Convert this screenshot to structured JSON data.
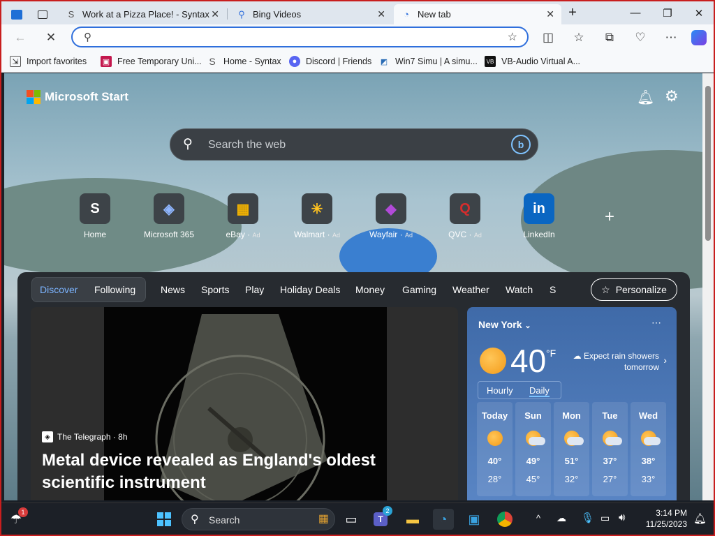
{
  "tabs": [
    {
      "title": "Work at a Pizza Place! - Syntax",
      "icon": "syntax-icon"
    },
    {
      "title": "Bing Videos",
      "icon": "search-icon"
    },
    {
      "title": "New tab",
      "icon": "edge-icon",
      "active": true
    }
  ],
  "address_bar": {
    "value": "",
    "placeholder": ""
  },
  "favorites": [
    {
      "label": "Import favorites"
    },
    {
      "label": "Free Temporary Uni..."
    },
    {
      "label": "Home - Syntax"
    },
    {
      "label": "Discord | Friends"
    },
    {
      "label": "Win7 Simu | A simu..."
    },
    {
      "label": "VB-Audio Virtual A..."
    }
  ],
  "start": {
    "brand": "Microsoft Start",
    "search_placeholder": "Search the web",
    "quick_links": [
      {
        "label": "Home",
        "ad": "",
        "tile": "S"
      },
      {
        "label": "Microsoft 365",
        "ad": "",
        "tile": "◈"
      },
      {
        "label": "eBay",
        "ad": "Ad",
        "tile": "▦"
      },
      {
        "label": "Walmart",
        "ad": "Ad",
        "tile": "✳"
      },
      {
        "label": "Wayfair",
        "ad": "Ad",
        "tile": "◆"
      },
      {
        "label": "QVC",
        "ad": "Ad",
        "tile": "Q"
      },
      {
        "label": "LinkedIn",
        "ad": "",
        "tile": "in"
      }
    ],
    "add_site": "+"
  },
  "feed": {
    "nav": [
      "Discover",
      "Following",
      "News",
      "Sports",
      "Play",
      "Holiday Deals",
      "Money",
      "Gaming",
      "Weather",
      "Watch",
      "S"
    ],
    "personalize": "Personalize",
    "hero": {
      "source": "The Telegraph · 8h",
      "title": "Metal device revealed as England's oldest scientific instrument"
    }
  },
  "weather": {
    "city": "New York",
    "temp": "40",
    "unit": "°F",
    "note": "Expect rain showers tomorrow",
    "tabs": [
      "Hourly",
      "Daily"
    ],
    "days": [
      {
        "name": "Today",
        "hi": "40°",
        "lo": "28°",
        "cloud": false
      },
      {
        "name": "Sun",
        "hi": "49°",
        "lo": "45°",
        "cloud": true
      },
      {
        "name": "Mon",
        "hi": "51°",
        "lo": "32°",
        "cloud": true
      },
      {
        "name": "Tue",
        "hi": "37°",
        "lo": "27°",
        "cloud": true
      },
      {
        "name": "Wed",
        "hi": "38°",
        "lo": "33°",
        "cloud": true
      }
    ]
  },
  "taskbar": {
    "search_label": "Search",
    "time": "3:14 PM",
    "date": "11/25/2023",
    "weather_badge": "1",
    "teams_badge": "2"
  }
}
